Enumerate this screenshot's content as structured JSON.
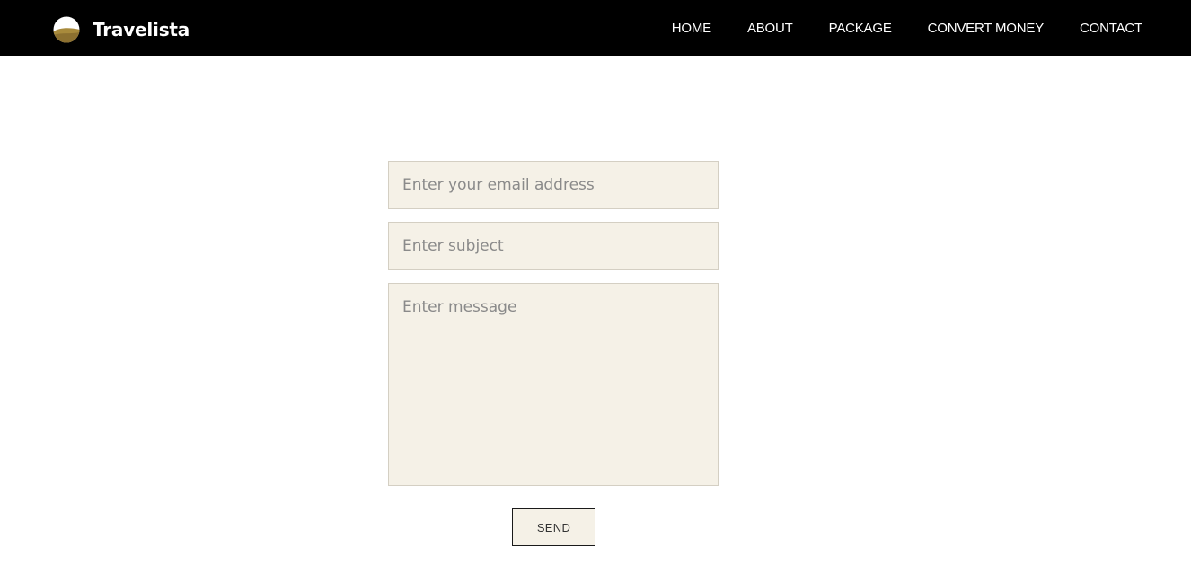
{
  "brand": {
    "name": "Travelista",
    "logo_icon": "sunset-dunes-icon"
  },
  "nav": {
    "items": [
      {
        "label": "HOME"
      },
      {
        "label": "ABOUT"
      },
      {
        "label": "PACKAGE"
      },
      {
        "label": "CONVERT MONEY"
      },
      {
        "label": "CONTACT"
      }
    ]
  },
  "contact_form": {
    "email_placeholder": "Enter your email address",
    "subject_placeholder": "Enter subject",
    "message_placeholder": "Enter message",
    "email_value": "",
    "subject_value": "",
    "message_value": "",
    "send_label": "SEND"
  },
  "colors": {
    "navbar_bg": "#000000",
    "field_bg": "#f5f1e7",
    "logo_gold": "#a88a3c"
  }
}
